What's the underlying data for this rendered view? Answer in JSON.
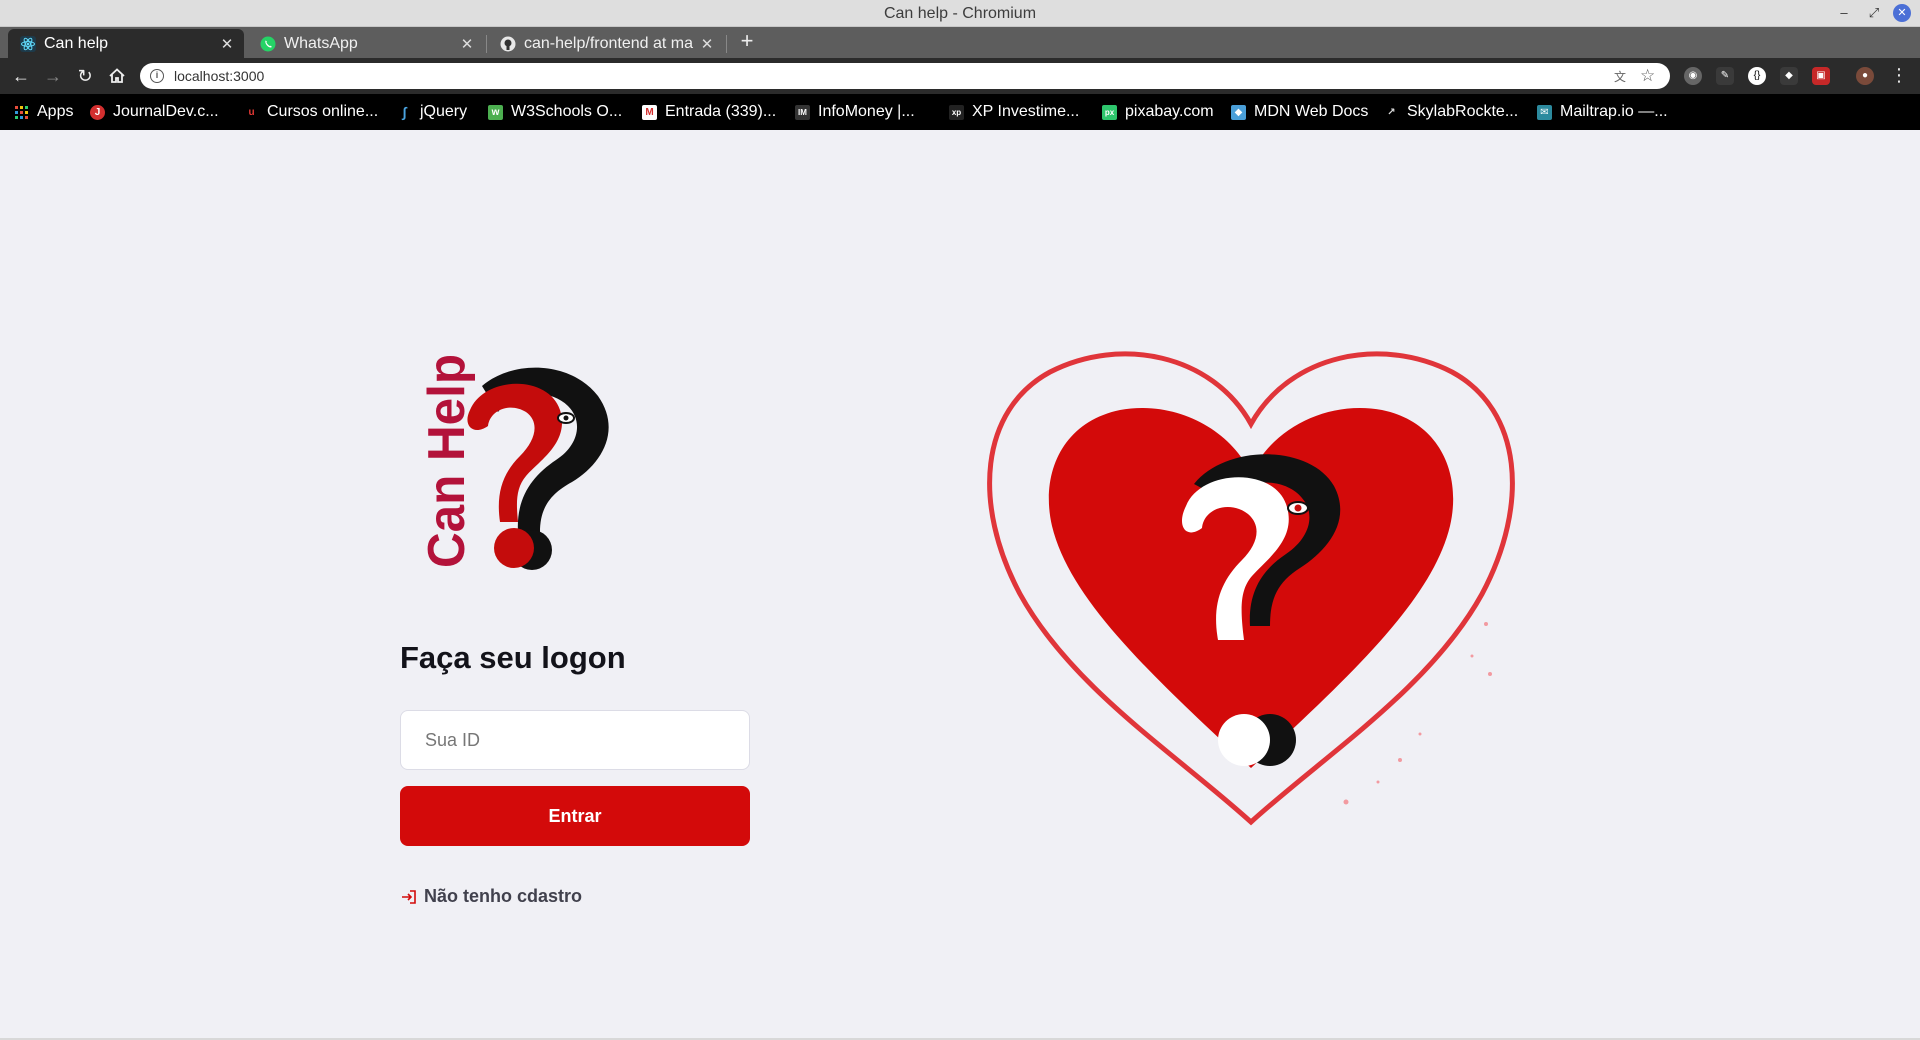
{
  "window": {
    "title": "Can help - Chromium"
  },
  "tabs": [
    {
      "label": "Can help",
      "icon": "react-icon",
      "active": true
    },
    {
      "label": "WhatsApp",
      "icon": "whatsapp-icon",
      "active": false
    },
    {
      "label": "can-help/frontend at ma",
      "icon": "github-icon",
      "active": false
    }
  ],
  "toolbar": {
    "url": "localhost:3000"
  },
  "bookmarks": [
    {
      "label": "Apps",
      "icon": "apps-grid-icon"
    },
    {
      "label": "JournalDev.c...",
      "icon": "journaldev-icon"
    },
    {
      "label": "Cursos online...",
      "icon": "udemy-icon"
    },
    {
      "label": "jQuery",
      "icon": "jquery-icon"
    },
    {
      "label": "W3Schools O...",
      "icon": "w3schools-icon"
    },
    {
      "label": "Entrada (339)...",
      "icon": "gmail-icon"
    },
    {
      "label": "InfoMoney |...",
      "icon": "infomoney-icon"
    },
    {
      "label": "XP Investime...",
      "icon": "xp-icon"
    },
    {
      "label": "pixabay.com",
      "icon": "pixabay-icon"
    },
    {
      "label": "MDN Web Docs",
      "icon": "mdn-icon"
    },
    {
      "label": "SkylabRockte...",
      "icon": "rocketseat-icon"
    },
    {
      "label": "Mailtrap.io —...",
      "icon": "mailtrap-icon"
    }
  ],
  "logo": {
    "text": "Can Help"
  },
  "login": {
    "heading": "Faça seu logon",
    "id_placeholder": "Sua ID",
    "submit_label": "Entrar",
    "register_label": "Não tenho cdastro"
  },
  "colors": {
    "brand_red": "#d30a0a",
    "page_bg": "#f0f0f5"
  }
}
